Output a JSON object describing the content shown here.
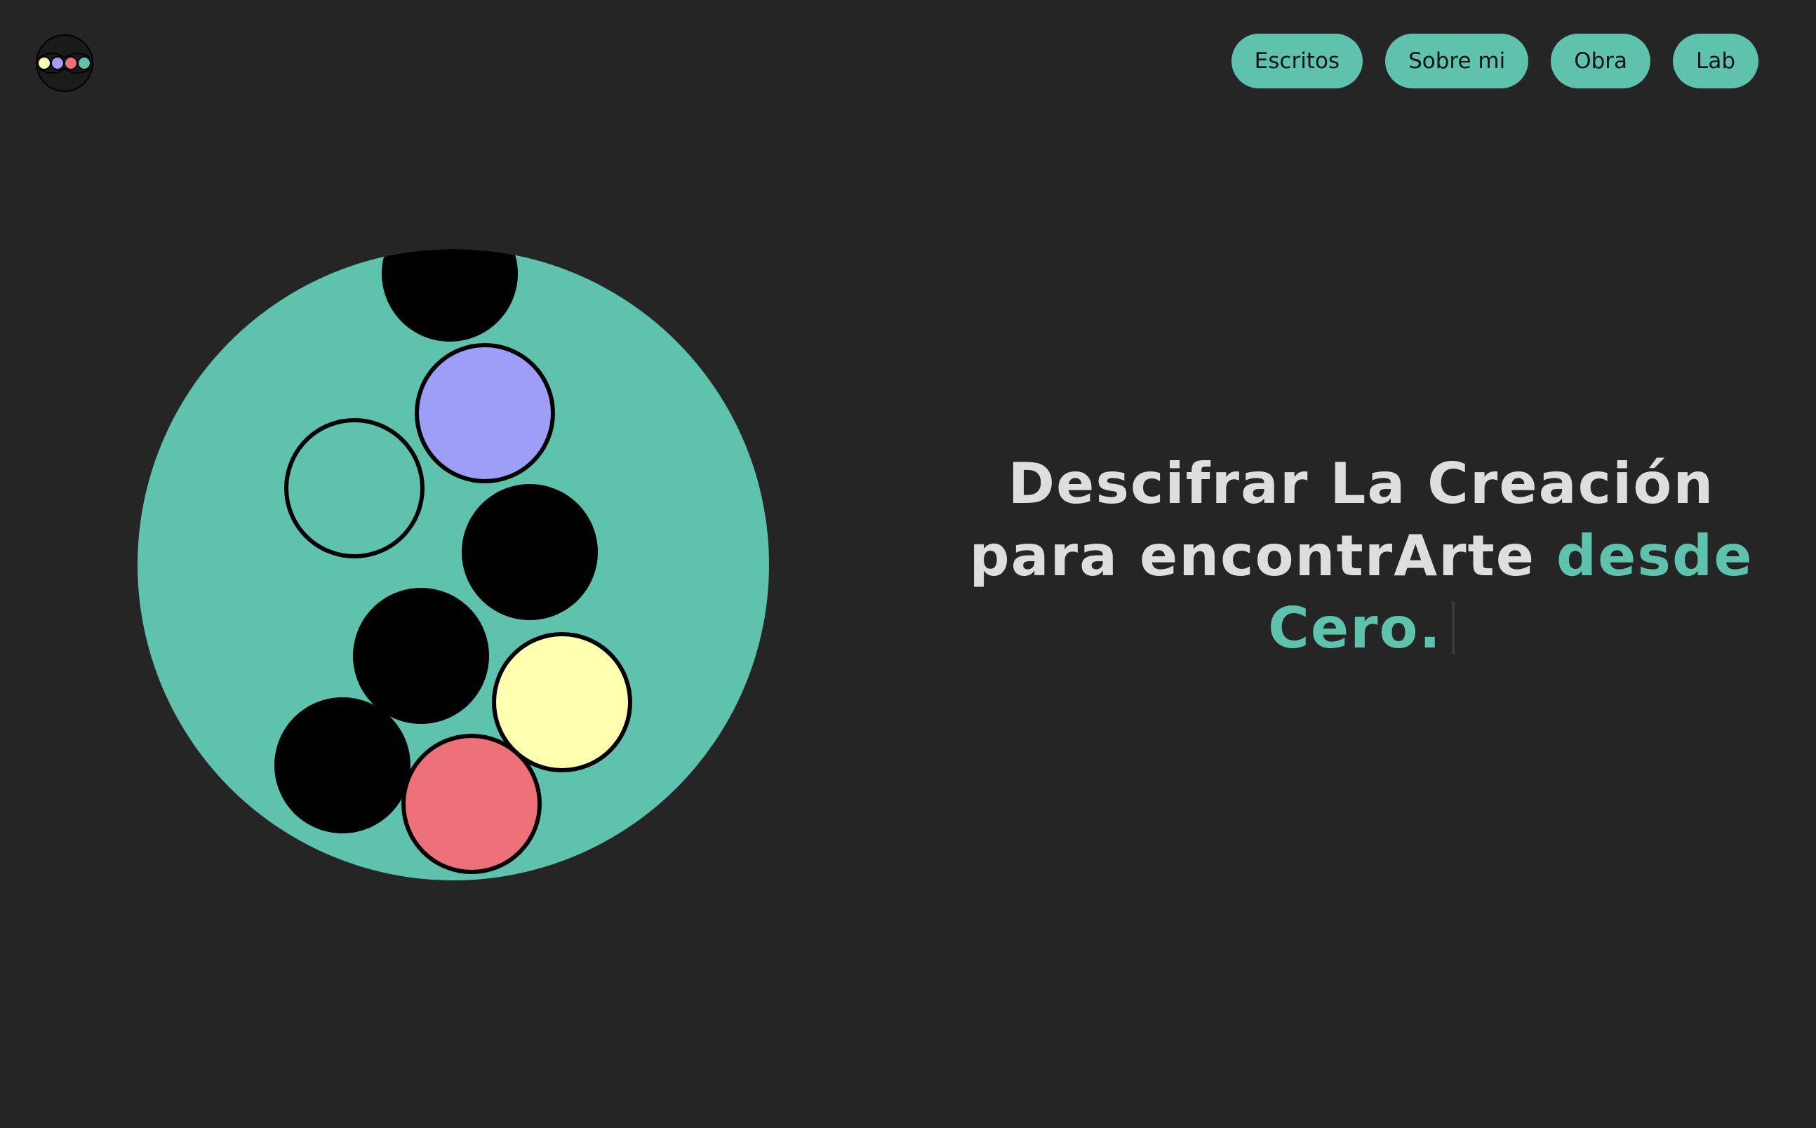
{
  "nav": {
    "items": [
      {
        "label": "Escritos"
      },
      {
        "label": "Sobre mi"
      },
      {
        "label": "Obra"
      },
      {
        "label": "Lab"
      }
    ]
  },
  "hero": {
    "line1": "Descifrar La Creación",
    "line2_plain": "para encontrArte ",
    "line2_accent": "desde",
    "line3_accent": "Cero."
  },
  "colors": {
    "background": "#252525",
    "accent": "#5ec2ac",
    "text": "#dedede",
    "purple": "#9e9ef8",
    "yellow": "#ffffb0",
    "red": "#ee7078",
    "black": "#000000"
  }
}
